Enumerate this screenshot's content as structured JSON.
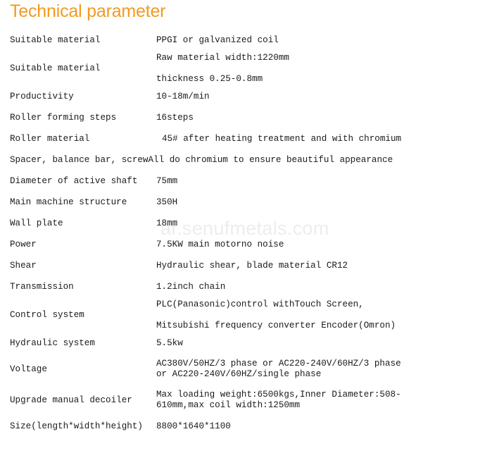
{
  "title": "Technical parameter",
  "theme": {
    "title_color": "#F29A1F",
    "text_color": "#1a1a1a",
    "background": "#ffffff",
    "watermark_color": "#ededed"
  },
  "watermark": {
    "text": "ar.senufmetals.com"
  },
  "table": {
    "rows": [
      {
        "label": "Suitable  material",
        "values": [
          "PPGI  or  galvanized  coil"
        ]
      },
      {
        "label": "Suitable  material",
        "values": [
          "Raw  material  width:1220mm",
          "thickness 0.25-0.8mm"
        ]
      },
      {
        "label": "Productivity",
        "values": [
          "10-18m/min"
        ]
      },
      {
        "label": "Roller  forming  steps",
        "values": [
          "16steps"
        ]
      },
      {
        "label": "Roller  material",
        "values": [
          "45#  after  heating  treatment  and  with  chromium"
        ]
      },
      {
        "label": "Spacer,  balance  bar,  screwAll  do  chromium  to  ensure  beautiful  appearance",
        "values": [
          ""
        ]
      },
      {
        "label": "Diameter  of  active  shaft",
        "values": [
          "75mm"
        ]
      },
      {
        "label": "Main  machine  structure",
        "values": [
          "350H"
        ]
      },
      {
        "label": "Wall  plate",
        "values": [
          "18mm"
        ]
      },
      {
        "label": "Power",
        "values": [
          "7.5KW  main  motorno  noise"
        ]
      },
      {
        "label": "Shear",
        "values": [
          "Hydraulic  shear,  blade  material  CR12"
        ]
      },
      {
        "label": "Transmission",
        "values": [
          "1.2inch  chain"
        ]
      },
      {
        "label": "Control  system",
        "values": [
          "PLC(Panasonic)control withTouch Screen,",
          "Mitsubishi frequency converter  Encoder(Omron)"
        ]
      },
      {
        "label": "Hydraulic  system",
        "values": [
          "5.5kw"
        ]
      },
      {
        "label": "Voltage",
        "values": [
          "AC380V/50HZ/3  phase  or  AC220-240V/60HZ/3  phase    or  AC220-240V/60HZ/single  phase"
        ]
      },
      {
        "label": "Upgrade  manual  decoiler",
        "values": [
          "Max  loading  weight:6500kgs,Inner  Diameter:508-610mm,max  coil  width:1250mm"
        ]
      },
      {
        "label": "Size(length*width*height)",
        "values": [
          "8800*1640*1100"
        ]
      }
    ]
  }
}
